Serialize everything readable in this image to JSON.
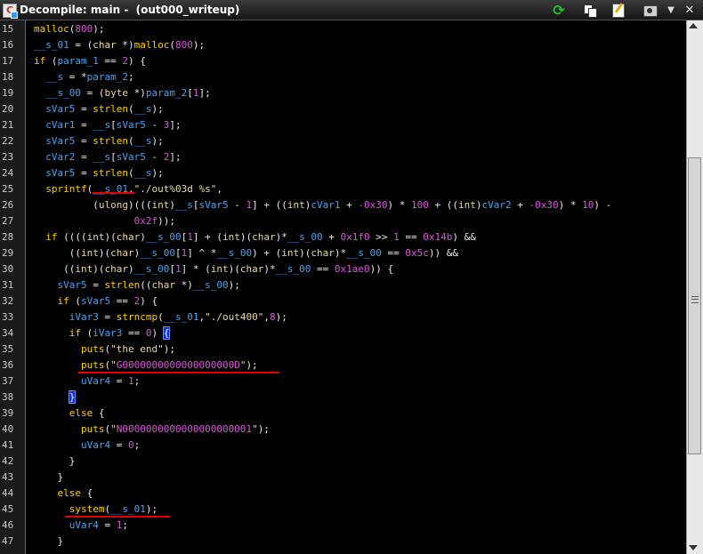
{
  "window": {
    "title": "Decompile: main -  (out000_writeup)"
  },
  "toolbar": {
    "refresh_icon": "refresh-icon",
    "copy_icon": "copy-icon",
    "edit_icon": "edit-icon",
    "snapshot_icon": "camera-icon",
    "menu_icon": "chevron-down-icon",
    "close_icon": "close-icon"
  },
  "colors": {
    "keyword": "#ffd200",
    "variable": "#4aa3f0",
    "string": "#e8d9a0",
    "number": "#d85ad8",
    "highlight": "#0a31d6",
    "underline": "#e50000"
  },
  "code_lines": [
    {
      "n": "15",
      "tokens": [
        [
          "kw",
          "malloc"
        ],
        [
          "op",
          "("
        ],
        [
          "num",
          "800"
        ],
        [
          "op",
          ");"
        ]
      ]
    },
    {
      "n": "16",
      "tokens": [
        [
          "var",
          "__s_01"
        ],
        [
          "op",
          " = ("
        ],
        [
          "type",
          "char"
        ],
        [
          "op",
          " *)"
        ],
        [
          "kw",
          "malloc"
        ],
        [
          "op",
          "("
        ],
        [
          "num",
          "800"
        ],
        [
          "op",
          ");"
        ]
      ]
    },
    {
      "n": "17",
      "tokens": [
        [
          "kw",
          "if"
        ],
        [
          "op",
          " ("
        ],
        [
          "var",
          "param_1"
        ],
        [
          "op",
          " == "
        ],
        [
          "num",
          "2"
        ],
        [
          "op",
          ") {"
        ]
      ]
    },
    {
      "n": "18",
      "tokens": [
        [
          "op",
          "  "
        ],
        [
          "var",
          "__s"
        ],
        [
          "op",
          " = *"
        ],
        [
          "var",
          "param_2"
        ],
        [
          "op",
          ";"
        ]
      ]
    },
    {
      "n": "19",
      "tokens": [
        [
          "op",
          "  "
        ],
        [
          "var",
          "__s_00"
        ],
        [
          "op",
          " = ("
        ],
        [
          "type",
          "byte"
        ],
        [
          "op",
          " *)"
        ],
        [
          "var",
          "param_2"
        ],
        [
          "op",
          "["
        ],
        [
          "num",
          "1"
        ],
        [
          "op",
          "];"
        ]
      ]
    },
    {
      "n": "20",
      "tokens": [
        [
          "op",
          "  "
        ],
        [
          "var",
          "sVar5"
        ],
        [
          "op",
          " = "
        ],
        [
          "kw",
          "strlen"
        ],
        [
          "op",
          "("
        ],
        [
          "var",
          "__s"
        ],
        [
          "op",
          ");"
        ]
      ]
    },
    {
      "n": "21",
      "tokens": [
        [
          "op",
          "  "
        ],
        [
          "var",
          "cVar1"
        ],
        [
          "op",
          " = "
        ],
        [
          "var",
          "__s"
        ],
        [
          "op",
          "["
        ],
        [
          "var",
          "sVar5"
        ],
        [
          "op",
          " - "
        ],
        [
          "num",
          "3"
        ],
        [
          "op",
          "];"
        ]
      ]
    },
    {
      "n": "22",
      "tokens": [
        [
          "op",
          "  "
        ],
        [
          "var",
          "sVar5"
        ],
        [
          "op",
          " = "
        ],
        [
          "kw",
          "strlen"
        ],
        [
          "op",
          "("
        ],
        [
          "var",
          "__s"
        ],
        [
          "op",
          ");"
        ]
      ]
    },
    {
      "n": "23",
      "tokens": [
        [
          "op",
          "  "
        ],
        [
          "var",
          "cVar2"
        ],
        [
          "op",
          " = "
        ],
        [
          "var",
          "__s"
        ],
        [
          "op",
          "["
        ],
        [
          "var",
          "sVar5"
        ],
        [
          "op",
          " - "
        ],
        [
          "num",
          "2"
        ],
        [
          "op",
          "];"
        ]
      ]
    },
    {
      "n": "24",
      "tokens": [
        [
          "op",
          "  "
        ],
        [
          "var",
          "sVar5"
        ],
        [
          "op",
          " = "
        ],
        [
          "kw",
          "strlen"
        ],
        [
          "op",
          "("
        ],
        [
          "var",
          "__s"
        ],
        [
          "op",
          ");"
        ]
      ]
    },
    {
      "n": "25",
      "tokens": [
        [
          "op",
          "  "
        ],
        [
          "kw",
          "sprintf"
        ],
        [
          "op",
          "("
        ],
        [
          "var",
          "__s_01"
        ],
        [
          "op",
          ","
        ],
        [
          "str",
          "\"./out%03d %s\""
        ],
        [
          "op",
          ","
        ]
      ]
    },
    {
      "n": "26",
      "tokens": [
        [
          "op",
          "          ("
        ],
        [
          "type",
          "ulong"
        ],
        [
          "op",
          ")((("
        ],
        [
          "type",
          "int"
        ],
        [
          "op",
          ")"
        ],
        [
          "var",
          "__s"
        ],
        [
          "op",
          "["
        ],
        [
          "var",
          "sVar5"
        ],
        [
          "op",
          " - "
        ],
        [
          "num",
          "1"
        ],
        [
          "op",
          "] + (("
        ],
        [
          "type",
          "int"
        ],
        [
          "op",
          ")"
        ],
        [
          "var",
          "cVar1"
        ],
        [
          "op",
          " + "
        ],
        [
          "num",
          "-0x30"
        ],
        [
          "op",
          ") * "
        ],
        [
          "num",
          "100"
        ],
        [
          "op",
          " + (("
        ],
        [
          "type",
          "int"
        ],
        [
          "op",
          ")"
        ],
        [
          "var",
          "cVar2"
        ],
        [
          "op",
          " + "
        ],
        [
          "num",
          "-0x30"
        ],
        [
          "op",
          ") * "
        ],
        [
          "num",
          "10"
        ],
        [
          "op",
          ") -"
        ]
      ]
    },
    {
      "n": "27",
      "tokens": [
        [
          "op",
          "                 "
        ],
        [
          "num",
          "0x2f"
        ],
        [
          "op",
          "));"
        ]
      ]
    },
    {
      "n": "28",
      "tokens": [
        [
          "op",
          "  "
        ],
        [
          "kw",
          "if"
        ],
        [
          "op",
          " (((("
        ],
        [
          "type",
          "int"
        ],
        [
          "op",
          ")("
        ],
        [
          "type",
          "char"
        ],
        [
          "op",
          ")"
        ],
        [
          "var",
          "__s_00"
        ],
        [
          "op",
          "["
        ],
        [
          "num",
          "1"
        ],
        [
          "op",
          "] + ("
        ],
        [
          "type",
          "int"
        ],
        [
          "op",
          ")("
        ],
        [
          "type",
          "char"
        ],
        [
          "op",
          ")*"
        ],
        [
          "var",
          "__s_00"
        ],
        [
          "op",
          " + "
        ],
        [
          "num",
          "0x1f0"
        ],
        [
          "op",
          " >> "
        ],
        [
          "num",
          "1"
        ],
        [
          "op",
          " == "
        ],
        [
          "num",
          "0x14b"
        ],
        [
          "op",
          ") &&"
        ]
      ]
    },
    {
      "n": "29",
      "tokens": [
        [
          "op",
          "      (("
        ],
        [
          "type",
          "int"
        ],
        [
          "op",
          ")("
        ],
        [
          "type",
          "char"
        ],
        [
          "op",
          ")"
        ],
        [
          "var",
          "__s_00"
        ],
        [
          "op",
          "["
        ],
        [
          "num",
          "1"
        ],
        [
          "op",
          "] ^ *"
        ],
        [
          "var",
          "__s_00"
        ],
        [
          "op",
          ") + ("
        ],
        [
          "type",
          "int"
        ],
        [
          "op",
          ")("
        ],
        [
          "type",
          "char"
        ],
        [
          "op",
          ")*"
        ],
        [
          "var",
          "__s_00"
        ],
        [
          "op",
          " == "
        ],
        [
          "num",
          "0x5c"
        ],
        [
          "op",
          ")) &&"
        ]
      ]
    },
    {
      "n": "30",
      "tokens": [
        [
          "op",
          "     (("
        ],
        [
          "type",
          "int"
        ],
        [
          "op",
          ")("
        ],
        [
          "type",
          "char"
        ],
        [
          "op",
          ")"
        ],
        [
          "var",
          "__s_00"
        ],
        [
          "op",
          "["
        ],
        [
          "num",
          "1"
        ],
        [
          "op",
          "] * ("
        ],
        [
          "type",
          "int"
        ],
        [
          "op",
          ")("
        ],
        [
          "type",
          "char"
        ],
        [
          "op",
          ")*"
        ],
        [
          "var",
          "__s_00"
        ],
        [
          "op",
          " == "
        ],
        [
          "num",
          "0x1ae0"
        ],
        [
          "op",
          ")) {"
        ]
      ]
    },
    {
      "n": "31",
      "tokens": [
        [
          "op",
          "    "
        ],
        [
          "var",
          "sVar5"
        ],
        [
          "op",
          " = "
        ],
        [
          "kw",
          "strlen"
        ],
        [
          "op",
          "(("
        ],
        [
          "type",
          "char"
        ],
        [
          "op",
          " *)"
        ],
        [
          "var",
          "__s_00"
        ],
        [
          "op",
          ");"
        ]
      ]
    },
    {
      "n": "32",
      "tokens": [
        [
          "op",
          "    "
        ],
        [
          "kw",
          "if"
        ],
        [
          "op",
          " ("
        ],
        [
          "var",
          "sVar5"
        ],
        [
          "op",
          " == "
        ],
        [
          "num",
          "2"
        ],
        [
          "op",
          ") {"
        ]
      ]
    },
    {
      "n": "33",
      "tokens": [
        [
          "op",
          "      "
        ],
        [
          "var",
          "iVar3"
        ],
        [
          "op",
          " = "
        ],
        [
          "kw",
          "strncmp"
        ],
        [
          "op",
          "("
        ],
        [
          "var",
          "__s_01"
        ],
        [
          "op",
          ","
        ],
        [
          "str",
          "\"./out400\""
        ],
        [
          "op",
          ","
        ],
        [
          "num",
          "8"
        ],
        [
          "op",
          ");"
        ]
      ]
    },
    {
      "n": "34",
      "tokens": [
        [
          "op",
          "      "
        ],
        [
          "kw",
          "if"
        ],
        [
          "op",
          " ("
        ],
        [
          "var",
          "iVar3"
        ],
        [
          "op",
          " == "
        ],
        [
          "num",
          "0"
        ],
        [
          "op",
          ") "
        ],
        [
          "hl",
          "{"
        ]
      ]
    },
    {
      "n": "35",
      "tokens": [
        [
          "op",
          "        "
        ],
        [
          "kw",
          "puts"
        ],
        [
          "op",
          "("
        ],
        [
          "str",
          "\"the end\""
        ],
        [
          "op",
          ");"
        ]
      ]
    },
    {
      "n": "36",
      "tokens": [
        [
          "op",
          "        "
        ],
        [
          "kw",
          "puts"
        ],
        [
          "op",
          "("
        ],
        [
          "str",
          "\""
        ],
        [
          "num",
          "G0000000000000000000D"
        ],
        [
          "str",
          "\""
        ],
        [
          "op",
          ");"
        ]
      ]
    },
    {
      "n": "37",
      "tokens": [
        [
          "op",
          "        "
        ],
        [
          "var",
          "uVar4"
        ],
        [
          "op",
          " = "
        ],
        [
          "num",
          "1"
        ],
        [
          "op",
          ";"
        ]
      ]
    },
    {
      "n": "38",
      "tokens": [
        [
          "op",
          "      "
        ],
        [
          "hl",
          "}"
        ]
      ]
    },
    {
      "n": "39",
      "tokens": [
        [
          "op",
          "      "
        ],
        [
          "kw",
          "else"
        ],
        [
          "op",
          " {"
        ]
      ]
    },
    {
      "n": "40",
      "tokens": [
        [
          "op",
          "        "
        ],
        [
          "kw",
          "puts"
        ],
        [
          "op",
          "("
        ],
        [
          "str",
          "\""
        ],
        [
          "num",
          "N0000000000000000000001"
        ],
        [
          "str",
          "\""
        ],
        [
          "op",
          ");"
        ]
      ]
    },
    {
      "n": "41",
      "tokens": [
        [
          "op",
          "        "
        ],
        [
          "var",
          "uVar4"
        ],
        [
          "op",
          " = "
        ],
        [
          "num",
          "0"
        ],
        [
          "op",
          ";"
        ]
      ]
    },
    {
      "n": "42",
      "tokens": [
        [
          "op",
          "      }"
        ]
      ]
    },
    {
      "n": "43",
      "tokens": [
        [
          "op",
          "    }"
        ]
      ]
    },
    {
      "n": "44",
      "tokens": [
        [
          "op",
          "    "
        ],
        [
          "kw",
          "else"
        ],
        [
          "op",
          " {"
        ]
      ]
    },
    {
      "n": "45",
      "tokens": [
        [
          "op",
          "      "
        ],
        [
          "kw",
          "system"
        ],
        [
          "op",
          "("
        ],
        [
          "var",
          "__s_01"
        ],
        [
          "op",
          ");"
        ]
      ]
    },
    {
      "n": "46",
      "tokens": [
        [
          "op",
          "      "
        ],
        [
          "var",
          "uVar4"
        ],
        [
          "op",
          " = "
        ],
        [
          "num",
          "1"
        ],
        [
          "op",
          ";"
        ]
      ]
    },
    {
      "n": "47",
      "tokens": [
        [
          "op",
          "    }"
        ]
      ]
    }
  ]
}
